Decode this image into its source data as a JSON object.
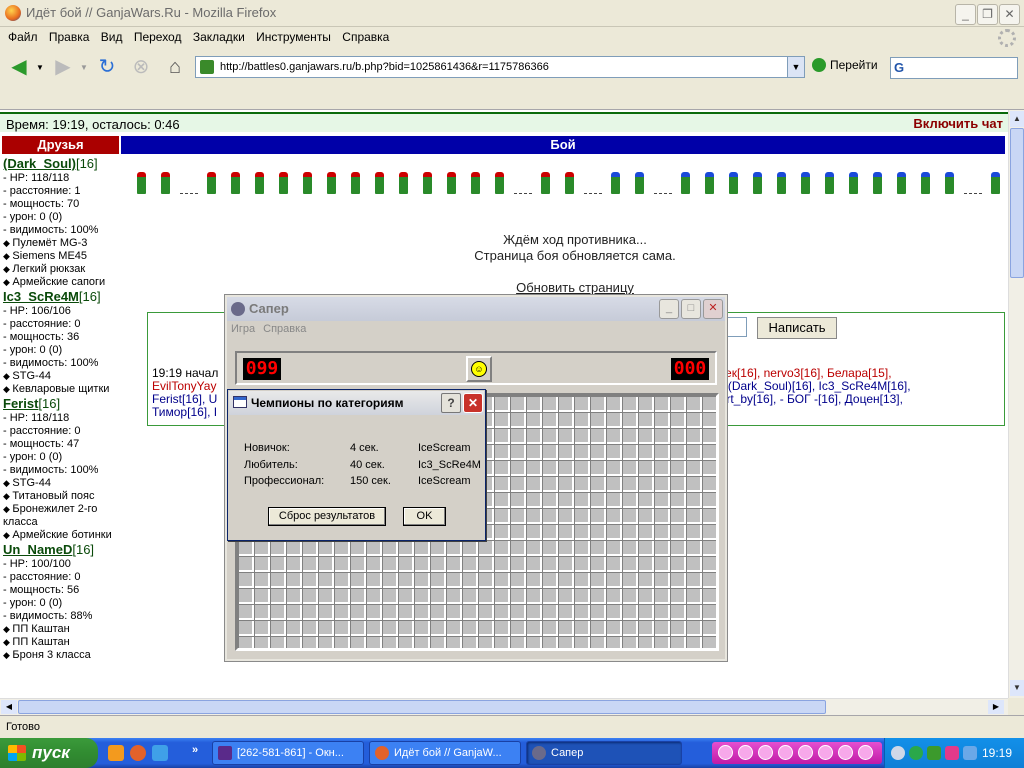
{
  "window": {
    "title": "Идёт бой // GanjaWars.Ru - Mozilla Firefox"
  },
  "menu": [
    "Файл",
    "Правка",
    "Вид",
    "Переход",
    "Закладки",
    "Инструменты",
    "Справка"
  ],
  "nav": {
    "url": "http://battles0.ganjawars.ru/b.php?bid=1025861436&r=1175786366",
    "go_label": "Перейти",
    "search_placeholder": ""
  },
  "page": {
    "time_text": "Время: 19:19, осталось:  0:46",
    "chat_toggle": "Включить чат",
    "friends_header": "Друзья",
    "battle_header": "Бой",
    "wait_line1": "Ждём ход противника...",
    "wait_line2": "Страница боя обновляется сама.",
    "refresh_link": "Обновить страницу",
    "send_button": "Написать",
    "chat_line1_a": "19:19 начал",
    "chat_line1_b": "ль Санек[16], nervo3[16], Белара[15],",
    "chat_line2_a": "EvilTonyYay",
    "chat_line2_b": "vs (Dark_Soul)[16], Ic3_ScRe4M[16],",
    "chat_line3_a": "Ferist[16], U",
    "chat_line3_b": "Art_by[16], - БОГ -[16], Доцен[13],",
    "chat_line4_a": "Тимор[16], I"
  },
  "friends": [
    {
      "name": "(Dark_Soul)",
      "level": "[16]",
      "stats": [
        "- HP: 118/118",
        "- расстояние: 1",
        "- мощность: 70",
        "- урон: 0 (0)",
        "- видимость: 100%"
      ],
      "items": [
        "Пулемёт MG-3",
        "Siemens ME45",
        "Легкий рюкзак",
        "Армейские сапоги"
      ]
    },
    {
      "name": "Ic3_ScRe4M",
      "level": "[16]",
      "stats": [
        "- HP: 106/106",
        "- расстояние: 0",
        "- мощность: 36",
        "- урон: 0 (0)",
        "- видимость: 100%"
      ],
      "items": [
        "STG-44",
        "Кевларовые щитки"
      ]
    },
    {
      "name": "Ferist",
      "level": "[16]",
      "stats": [
        "- HP: 118/118",
        "- расстояние: 0",
        "- мощность: 47",
        "- урон: 0 (0)",
        "- видимость: 100%"
      ],
      "items": [
        "STG-44",
        "Титановый пояс",
        "Бронежилет 2-го класса",
        "Армейские ботинки"
      ]
    },
    {
      "name": "Un_NameD",
      "level": "[16]",
      "stats": [
        "- HP: 100/100",
        "- расстояние: 0",
        "- мощность: 56",
        "- урон: 0 (0)",
        "- видимость: 88%"
      ],
      "items": [
        "ПП Каштан",
        "ПП Каштан",
        "Броня 3 класса"
      ]
    }
  ],
  "minesweeper": {
    "title": "Сапер",
    "menu": [
      "Игра",
      "Справка"
    ],
    "mines_counter": "099",
    "timer": "000",
    "smiley": "☺"
  },
  "champions": {
    "title": "Чемпионы по категориям",
    "help": "?",
    "rows": [
      {
        "category": "Новичок:",
        "time": "4 сек.",
        "name": "IceScream"
      },
      {
        "category": "Любитель:",
        "time": "40 сек.",
        "name": "Ic3_ScRe4M"
      },
      {
        "category": "Профессионал:",
        "time": "150 сек.",
        "name": "IceScream"
      }
    ],
    "reset_button": "Сброс результатов",
    "ok_button": "OK"
  },
  "status": {
    "text": "Готово"
  },
  "taskbar": {
    "start": "пуск",
    "tasks": [
      "[262-581-861] - Окн...",
      "Идёт бой // GanjaW...",
      "Сапер"
    ],
    "clock": "19:19"
  },
  "colors": {
    "accent_green": "#0a6a0a",
    "friends_red": "#aa0000",
    "battle_blue": "#0000a8",
    "taskbar": "#245edb"
  }
}
